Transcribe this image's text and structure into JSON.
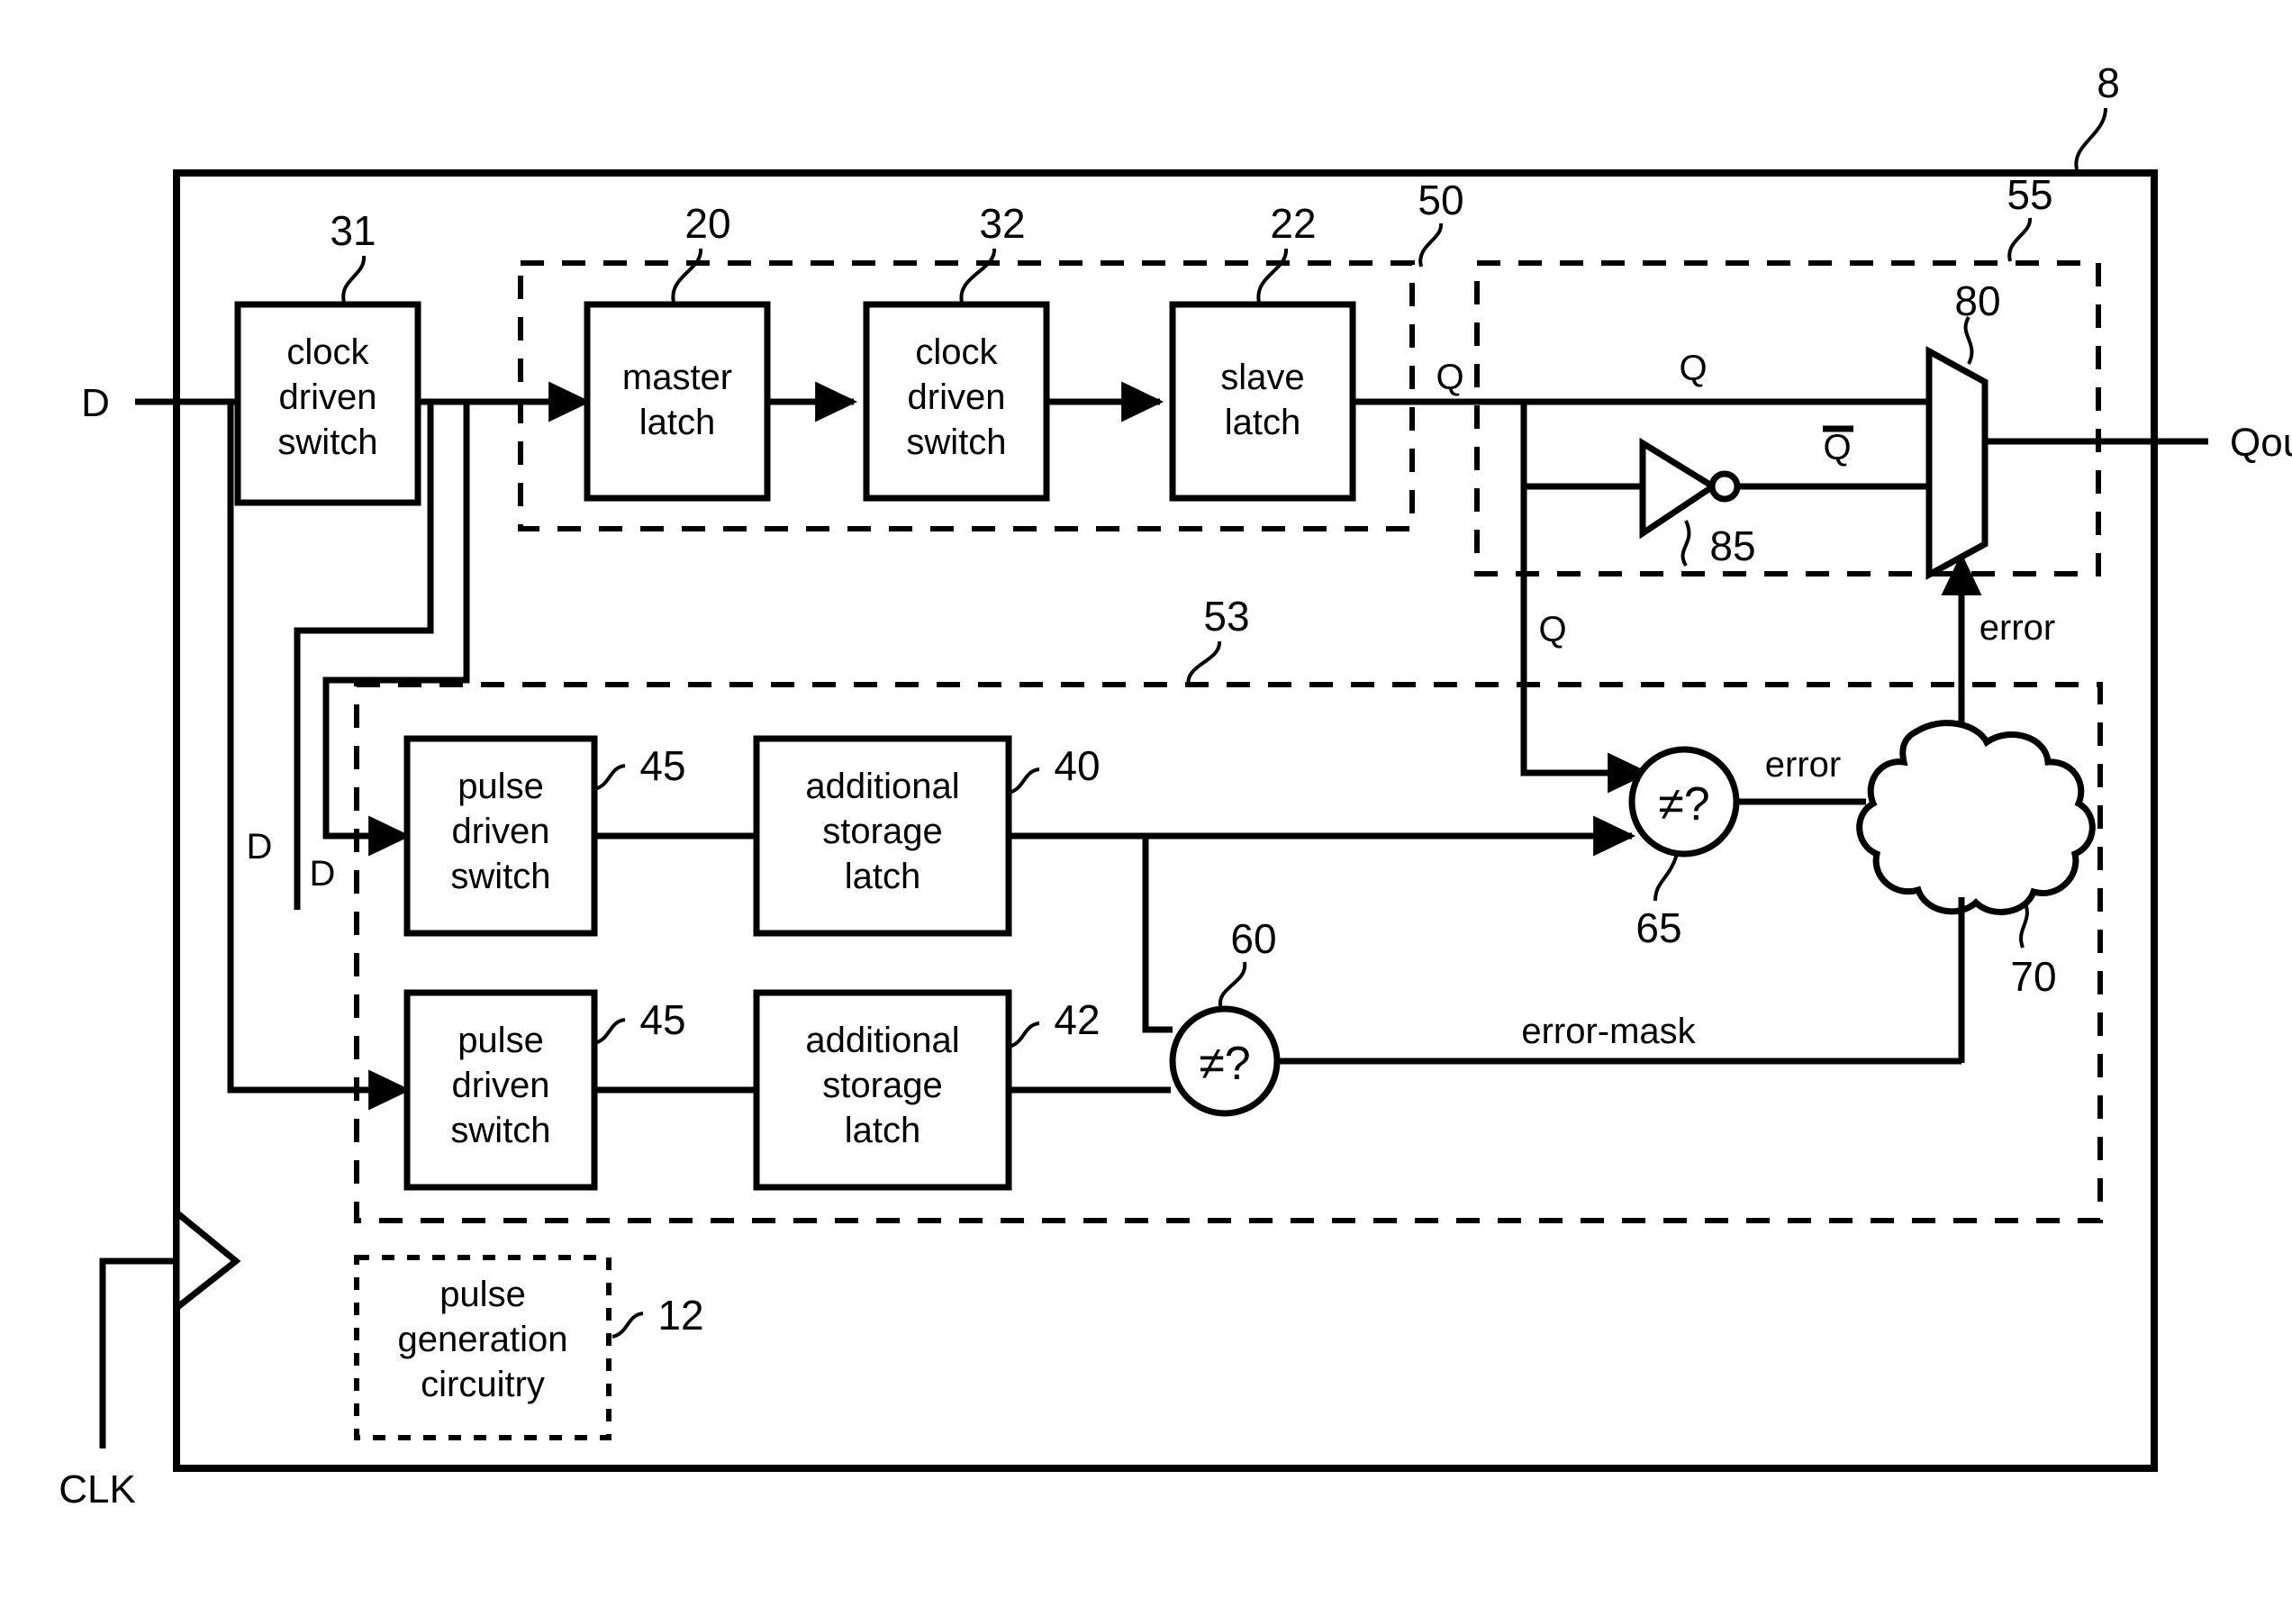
{
  "figure": {
    "title_ref": "8",
    "ports": {
      "data_in": "D",
      "clock_in": "CLK",
      "data_out": "Qout"
    },
    "blocks": [
      {
        "id": "clock-driven-switch-31",
        "ref": "31",
        "lines": [
          "clock",
          "driven",
          "switch"
        ]
      },
      {
        "id": "master-latch-20",
        "ref": "",
        "lines": [
          "master",
          "latch"
        ]
      },
      {
        "id": "clock-driven-switch-32",
        "ref": "",
        "lines": [
          "clock",
          "driven",
          "switch"
        ]
      },
      {
        "id": "slave-latch-22",
        "ref": "",
        "lines": [
          "slave",
          "latch"
        ]
      },
      {
        "id": "pulse-driven-switch-top",
        "ref": "45",
        "lines": [
          "pulse",
          "driven",
          "switch"
        ]
      },
      {
        "id": "additional-storage-latch-40",
        "ref": "40",
        "lines": [
          "additional",
          "storage",
          "latch"
        ]
      },
      {
        "id": "pulse-driven-switch-bottom",
        "ref": "45",
        "lines": [
          "pulse",
          "driven",
          "switch"
        ]
      },
      {
        "id": "additional-storage-latch-42",
        "ref": "42",
        "lines": [
          "additional",
          "storage",
          "latch"
        ]
      },
      {
        "id": "pulse-generation-circuitry-12",
        "ref": "12",
        "lines": [
          "pulse",
          "generation",
          "circuitry"
        ]
      }
    ],
    "refs": {
      "chip": "8",
      "clock_driven_switch_31": "31",
      "master_latch": "20",
      "clock_driven_switch_32": "32",
      "slave_latch": "22",
      "main_path_group": "50",
      "output_select_group": "55",
      "multiplexer": "80",
      "inverter": "85",
      "redundant_group": "53",
      "pulse_switch_top": "45",
      "storage_latch_top": "40",
      "pulse_switch_bottom": "45",
      "storage_latch_bottom": "42",
      "comparator_mask": "60",
      "comparator_error": "65",
      "error_control": "70",
      "pulse_generation": "12"
    },
    "signals": {
      "q_from_slave": "Q",
      "q_to_mux": "Q",
      "q_to_comparator": "Q",
      "qbar": "Q",
      "qbar_overline": true,
      "error_to_cloud": "error",
      "error_to_mux": "error",
      "error_mask": "error-mask",
      "d_left": "D",
      "d_right": "D"
    },
    "comparator_glyph": "≠?",
    "colors": {
      "ink": "#000000",
      "paper": "#ffffff"
    }
  }
}
